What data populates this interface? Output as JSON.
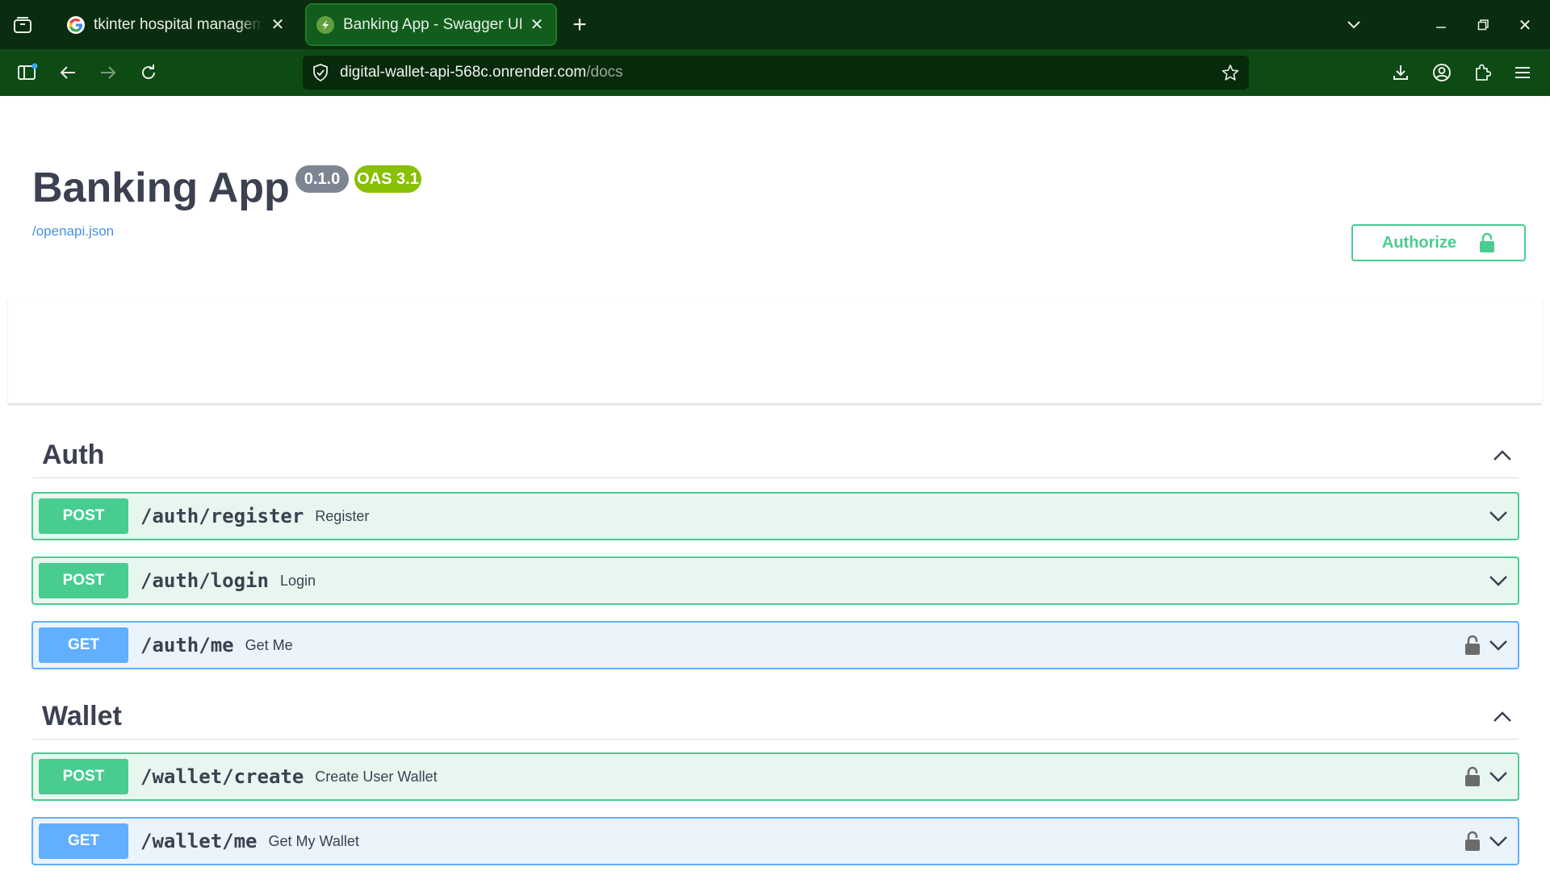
{
  "browser": {
    "tabs": [
      {
        "title": "tkinter hospital management",
        "active": false,
        "favicon": "google-g-icon"
      },
      {
        "title": "Banking App - Swagger UI",
        "active": true,
        "favicon": "swagger-icon"
      }
    ],
    "url": {
      "host": "digital-wallet-api-568c.onrender.com",
      "path": "/docs"
    }
  },
  "info": {
    "title": "Banking App",
    "version": "0.1.0",
    "oas": "OAS 3.1",
    "spec_link": "/openapi.json"
  },
  "authorize": {
    "label": "Authorize"
  },
  "tags": [
    {
      "name": "Auth",
      "operations": [
        {
          "method": "POST",
          "path": "/auth/register",
          "summary": "Register",
          "locked": false
        },
        {
          "method": "POST",
          "path": "/auth/login",
          "summary": "Login",
          "locked": false
        },
        {
          "method": "GET",
          "path": "/auth/me",
          "summary": "Get Me",
          "locked": true
        }
      ]
    },
    {
      "name": "Wallet",
      "operations": [
        {
          "method": "POST",
          "path": "/wallet/create",
          "summary": "Create User Wallet",
          "locked": true
        },
        {
          "method": "GET",
          "path": "/wallet/me",
          "summary": "Get My Wallet",
          "locked": true
        }
      ]
    }
  ],
  "colors": {
    "post": "#49cc90",
    "get": "#61affe",
    "version_badge": "#7d8492",
    "oas_badge": "#89bf04",
    "browser_tabbar": "#0b2d0f",
    "browser_navbar": "#0d4a14"
  }
}
